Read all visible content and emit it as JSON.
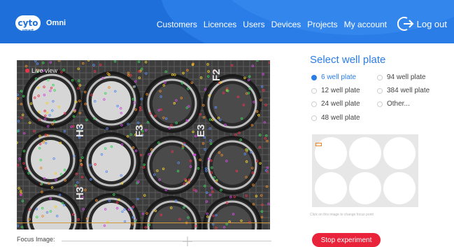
{
  "brand": {
    "logo_text": "cyto",
    "logo_sub": "smart",
    "app_name": "Omni"
  },
  "nav": {
    "items": [
      {
        "label": "Customers"
      },
      {
        "label": "Licences"
      },
      {
        "label": "Users"
      },
      {
        "label": "Devices"
      },
      {
        "label": "Projects"
      },
      {
        "label": "My account"
      }
    ],
    "logout_label": "Log out",
    "logout_icon": "logout-arrow-icon"
  },
  "live_view": {
    "label": "Live view",
    "well_labels": [
      "H3",
      "F3",
      "E3",
      "H3",
      "F2"
    ]
  },
  "focus": {
    "label": "Focus Image:",
    "value_percent": 60
  },
  "well_plate": {
    "title": "Select well plate",
    "options": [
      {
        "label": "6 well plate",
        "selected": true
      },
      {
        "label": "94 well plate",
        "selected": false
      },
      {
        "label": "12 well plate",
        "selected": false
      },
      {
        "label": "384 well plate",
        "selected": false
      },
      {
        "label": "24 well plate",
        "selected": false
      },
      {
        "label": "Other...",
        "selected": false
      },
      {
        "label": "48 well plate",
        "selected": false
      }
    ],
    "hint": "Click on this image to change focus point",
    "accent_color": "#2a7de6"
  },
  "actions": {
    "stop_label": "Stop experiment",
    "stop_color": "#e8233a"
  }
}
